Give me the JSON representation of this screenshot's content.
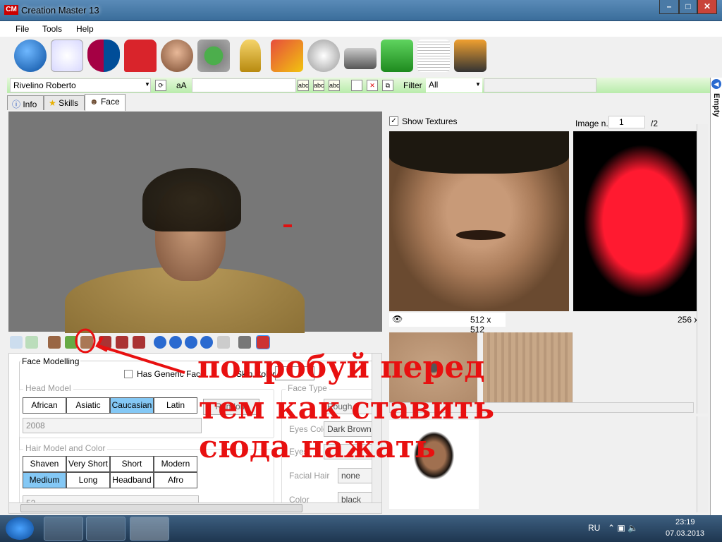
{
  "window": {
    "title": "Creation Master 13",
    "logo": "CM",
    "min": "–",
    "max": "□",
    "close": "✕"
  },
  "menu": [
    "File",
    "Tools",
    "Help"
  ],
  "toolbar_icons": [
    "globe-icon",
    "premier-league-icon",
    "barcelona-icon",
    "kit-icon",
    "player-icon",
    "stadium-icon",
    "trophy-icon",
    "cards-icon",
    "ball-icon",
    "boots-icon",
    "pitch-icon",
    "newspaper-icon",
    "gloves-icon"
  ],
  "greenbar": {
    "player": "Rivelino Roberto",
    "case_label": "aA",
    "filter_label": "Filter",
    "filter_value": "All"
  },
  "tabs": [
    {
      "label": "Info"
    },
    {
      "label": "Skills"
    },
    {
      "label": "Face"
    }
  ],
  "face": {
    "section": "Face Modelling",
    "generic_face": "Has Generic Face",
    "skin_color": "Skin Color",
    "head_model": "Head Model",
    "head_options": [
      "African",
      "Asiatic",
      "Caucasian",
      "Latin"
    ],
    "head_selected": "Caucasian",
    "random": "Random",
    "head_value": "2008",
    "hair_model": "Hair Model and Color",
    "hair_options": [
      "Shaven",
      "Very Short",
      "Short",
      "Modern",
      "Medium",
      "Long",
      "Headband",
      "Afro"
    ],
    "hair_selected": "Medium",
    "hair_value": "52",
    "face_type": "Face Type",
    "skin_type_value": "Rough",
    "eyes_color_label": "Eyes Color",
    "eyes_color": "Dark Brown",
    "eyes_label": "Eyes",
    "facial_hair_label": "Facial Hair",
    "facial_hair": "none",
    "color_label": "Color",
    "color": "black"
  },
  "textures": {
    "show_label": "Show Textures",
    "image_label": "Image n.",
    "image_n": "1",
    "image_total": "/2",
    "size1": "512 x 512",
    "size2": "256 x"
  },
  "sidebar": {
    "label": "Empty"
  },
  "taskbar": {
    "lang": "RU",
    "time": "23:19",
    "date": "07.03.2013"
  },
  "annotation": {
    "line1": "попробуй перед",
    "line2": "тем как ставить",
    "line3": "сюда нажать"
  }
}
